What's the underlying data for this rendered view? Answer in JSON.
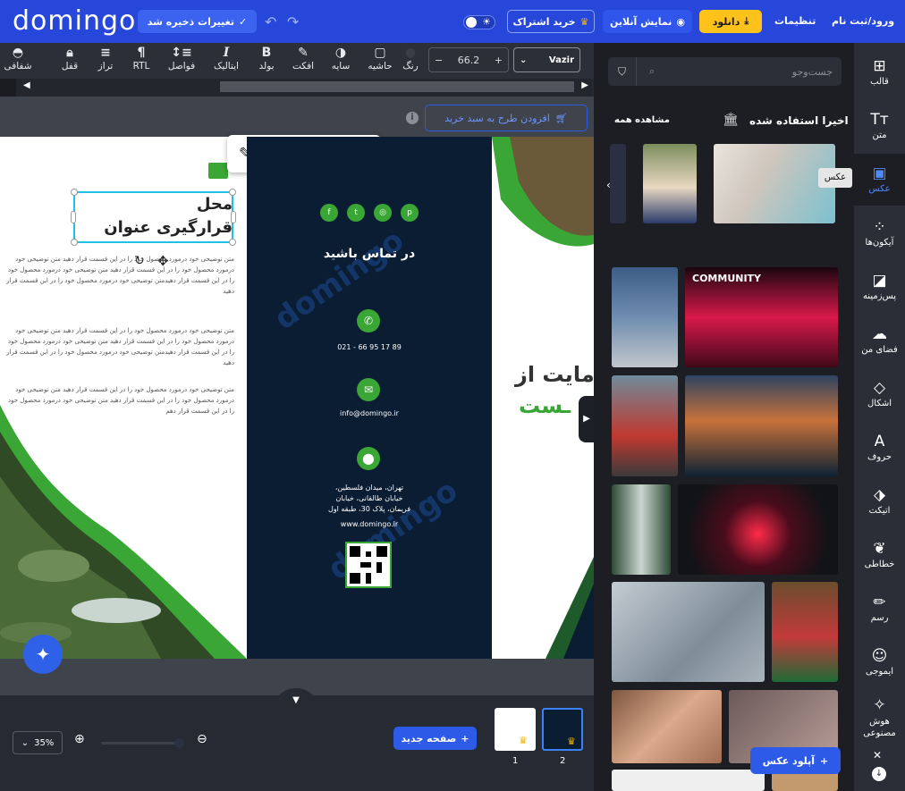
{
  "header": {
    "logo": "domingo",
    "save_label": "تغییرات ذخیره شد",
    "subscribe_label": "خرید اشتراک",
    "preview_label": "نمایش آنلاین",
    "download_label": "دانلود",
    "settings_label": "تنظیمات",
    "login_label": "ورود/ثبت نام"
  },
  "toolbar": {
    "items": [
      {
        "label": "شفافی",
        "icon": "opacity-icon"
      },
      {
        "label": "قفل",
        "icon": "lock-icon"
      },
      {
        "label": "تراز",
        "icon": "align-icon"
      },
      {
        "label": "RTL",
        "icon": "rtl-icon"
      },
      {
        "label": "فواصل",
        "icon": "spacing-icon"
      },
      {
        "label": "ایتالیک",
        "icon": "italic-icon"
      },
      {
        "label": "بولد",
        "icon": "bold-icon"
      },
      {
        "label": "افکت",
        "icon": "effect-icon"
      },
      {
        "label": "سایه",
        "icon": "shadow-icon"
      },
      {
        "label": "حاشیه",
        "icon": "border-icon"
      },
      {
        "label": "رنگ",
        "icon": "color-icon"
      }
    ],
    "font_size": "66.2",
    "font_name": "Vazir"
  },
  "canvas": {
    "add_to_cart": "افزودن طرح به سبد خرید"
  },
  "left_panel": {
    "title": "محل\nقرارگیری عنوان",
    "p1": "متن توضیحی خود درمورد محصول خود را در این قسمت قرار دهید متن توضیحی خود درمورد محصول خود را در این قسمت قرار دهید متن توضیحی خود درمورد محصول خود را در این قسمت قرار دهیدمتن توضیحی خود درمورد محصول خود را در این قسمت قرار دهید",
    "p2": "متن توضیحی خود درمورد محصول خود را در این قسمت قرار دهید متن توضیحی خود درمورد محصول خود را در این قسمت قرار دهید متن توضیحی خود درمورد محصول خود را در این قسمت قرار دهیدمتن توضیحی خود درمورد محصول خود را در این قسمت قرار دهید",
    "p3": "متن توضیحی خود درمورد محصول خود را در این قسمت قرار دهید متن توضیحی خود درمورد محصول خود را در این قسمت قرار دهید متن توضیحی خود درمورد محصول خود را در این قسمت قرار دهم"
  },
  "mid_panel": {
    "title": "در تماس باشید",
    "phone": "021 - 66 95 17 89",
    "email": "info@domingo.ir",
    "address": "تهران، میدان فلسطین، خیابان طالقانی، خیابان فریمان، پلاک 30، طبقه اول",
    "website": "www.domingo.ir",
    "watermark": "domingo"
  },
  "right_panel": {
    "line1": "مایت از",
    "line2": "ـست"
  },
  "bottom": {
    "zoom": "35%",
    "new_page": "صفحه جدید",
    "pages": [
      "1",
      "2"
    ]
  },
  "side": {
    "search_placeholder": "جست‌وجو",
    "recent_title": "اخیرا استفاده شده",
    "see_all": "مشاهده همه",
    "tooltip": "عکس",
    "upload": "آپلود عکس",
    "community_text": "COMMUNITY"
  },
  "rail": [
    {
      "label": "قالب",
      "icon": "template-icon"
    },
    {
      "label": "متن",
      "icon": "text-icon"
    },
    {
      "label": "عکس",
      "icon": "photo-icon"
    },
    {
      "label": "آیکون‌ها",
      "icon": "icons-icon"
    },
    {
      "label": "پس‌زمینه",
      "icon": "background-icon"
    },
    {
      "label": "فضای من",
      "icon": "cloud-upload-icon"
    },
    {
      "label": "اشکال",
      "icon": "shapes-icon"
    },
    {
      "label": "حروف",
      "icon": "letters-icon"
    },
    {
      "label": "اتیکت",
      "icon": "tag-icon"
    },
    {
      "label": "خطاطی",
      "icon": "calligraphy-icon"
    },
    {
      "label": "رسم",
      "icon": "draw-icon"
    },
    {
      "label": "ایموجی",
      "icon": "emoji-icon"
    },
    {
      "label": "هوش مصنوعی",
      "icon": "ai-icon"
    }
  ],
  "colors": {
    "brand": "#2647d9",
    "accent_green": "#3aa635",
    "yellow": "#ffc21a",
    "selection": "#22c0e8"
  }
}
